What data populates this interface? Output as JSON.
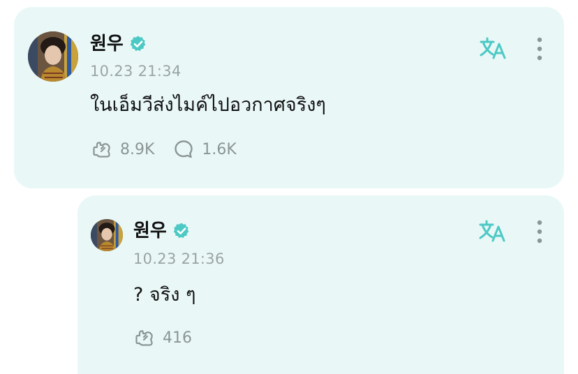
{
  "colors": {
    "card_bg": "#e9f8f7",
    "accent_teal": "#4cc9c4",
    "muted_text": "#9aa3a3"
  },
  "posts": [
    {
      "username": "원우",
      "verified_icon": "verified-badge-icon",
      "timestamp": "10.23 21:34",
      "text": "ในเอ็มวีส่งไมค์ไปอวกาศจริงๆ",
      "likes": "8.9K",
      "comments": "1.6K",
      "translate_icon": "translate-icon",
      "more_icon": "more-vertical-icon"
    },
    {
      "username": "원우",
      "verified_icon": "verified-badge-icon",
      "timestamp": "10.23 21:36",
      "text": "? จริง ๆ",
      "likes": "416",
      "translate_icon": "translate-icon",
      "more_icon": "more-vertical-icon"
    }
  ]
}
